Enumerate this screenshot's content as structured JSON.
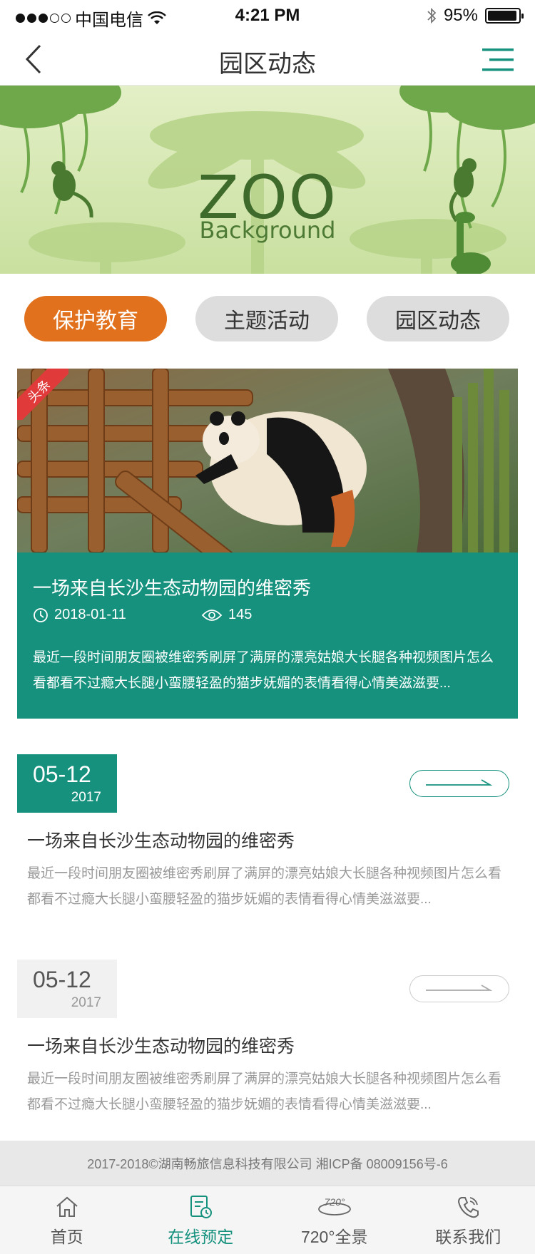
{
  "status_bar": {
    "carrier": "中国电信",
    "time": "4:21 PM",
    "battery_text": "95%",
    "battery_level": 0.95
  },
  "nav": {
    "title": "园区动态"
  },
  "banner": {
    "title": "ZOO",
    "subtitle": "Background"
  },
  "tabs": [
    {
      "label": "保护教育",
      "active": true
    },
    {
      "label": "主题活动",
      "active": false
    },
    {
      "label": "园区动态",
      "active": false
    }
  ],
  "headline": {
    "badge": "头条",
    "title": "一场来自长沙生态动物园的维密秀",
    "date": "2018-01-11",
    "views": "145",
    "summary": "最近一段时间朋友圈被维密秀刷屏了满屏的漂亮姑娘大长腿各种视频图片怎么看都看不过瘾大长腿小蛮腰轻盈的猫步妩媚的表情看得心情美滋滋要..."
  },
  "news": [
    {
      "date_md": "05-12",
      "year": "2017",
      "title": "一场来自长沙生态动物园的维密秀",
      "summary": "最近一段时间朋友圈被维密秀刷屏了满屏的漂亮姑娘大长腿各种视频图片怎么看都看不过瘾大长腿小蛮腰轻盈的猫步妩媚的表情看得心情美滋滋要...",
      "style": "teal"
    },
    {
      "date_md": "05-12",
      "year": "2017",
      "title": "一场来自长沙生态动物园的维密秀",
      "summary": "最近一段时间朋友圈被维密秀刷屏了满屏的漂亮姑娘大长腿各种视频图片怎么看都看不过瘾大长腿小蛮腰轻盈的猫步妩媚的表情看得心情美滋滋要...",
      "style": "gray"
    }
  ],
  "footer": {
    "copyright": "2017-2018©湖南畅旅信息科技有限公司  湘ICP备 08009156号-6"
  },
  "tab_bar": [
    {
      "label": "首页",
      "icon": "home-icon",
      "active": false
    },
    {
      "label": "在线预定",
      "icon": "booking-icon",
      "active": true
    },
    {
      "label": "720°全景",
      "icon": "panorama-720-icon",
      "active": false
    },
    {
      "label": "联系我们",
      "icon": "phone-icon",
      "active": false
    }
  ],
  "colors": {
    "teal": "#15917e",
    "orange": "#e2711d",
    "ribbon_red": "#e03a3a",
    "banner_green": "#c9e0a0"
  }
}
